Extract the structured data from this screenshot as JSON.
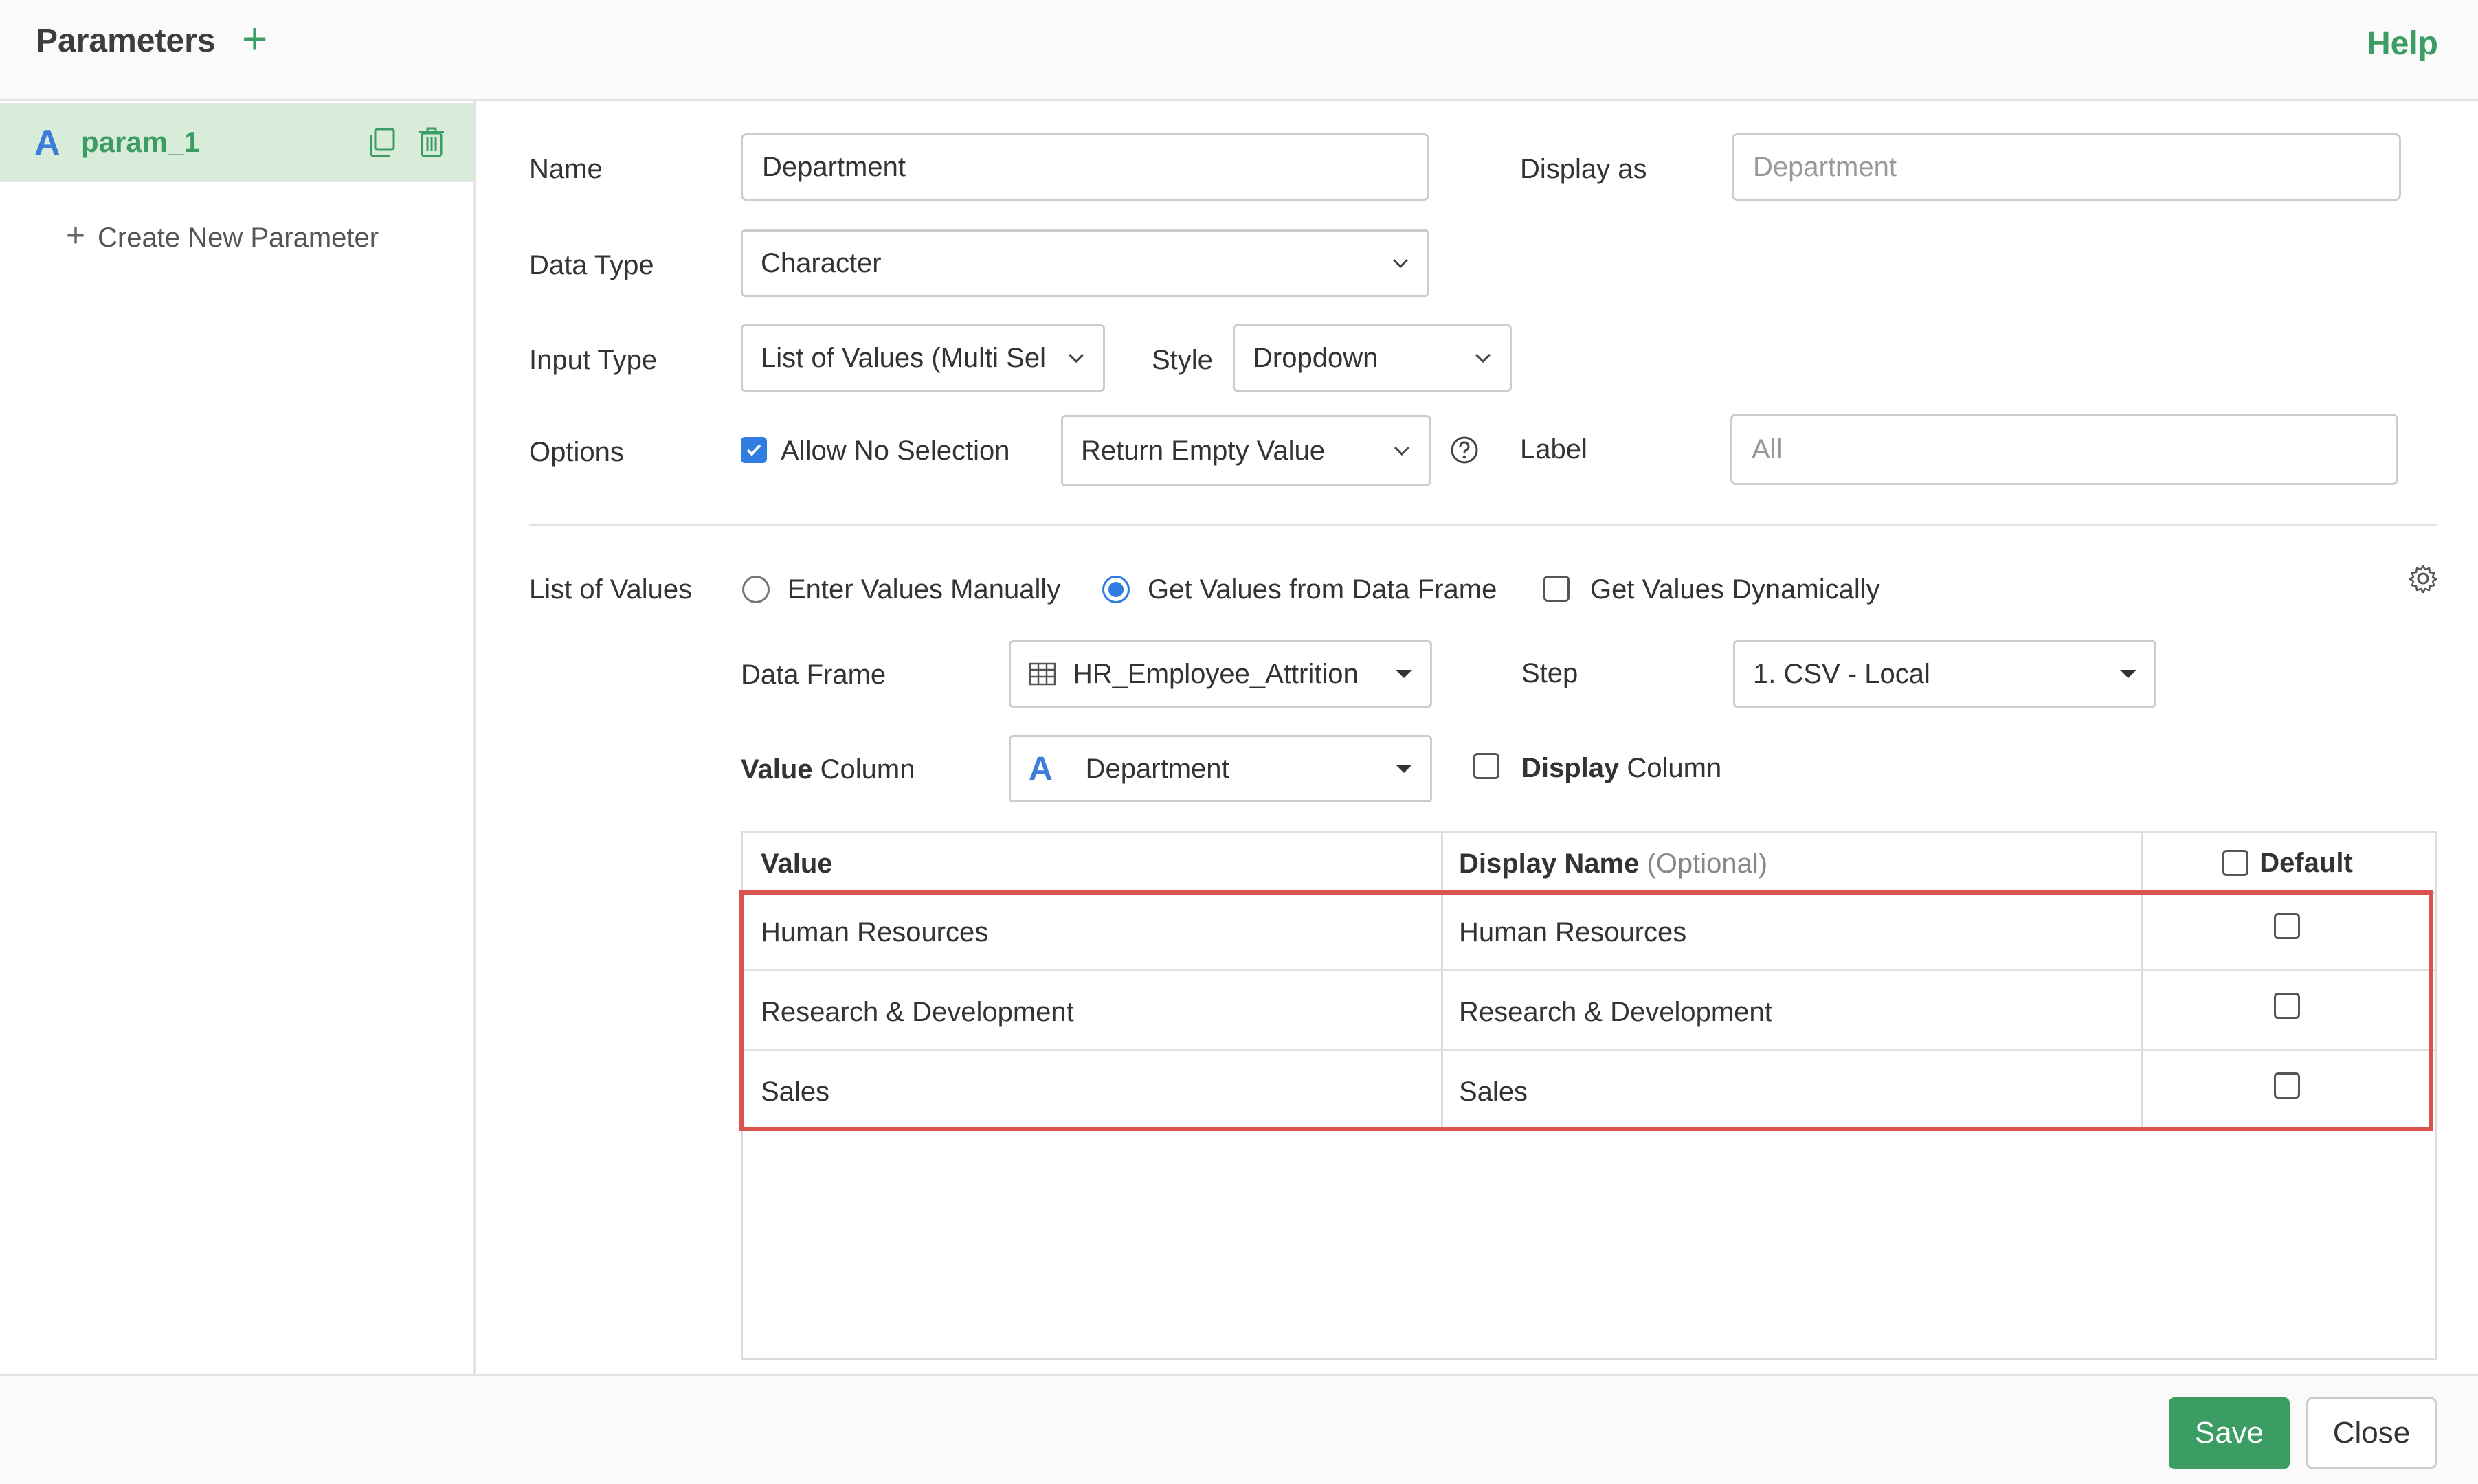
{
  "header": {
    "title": "Parameters",
    "add_icon": "plus-icon",
    "help": "Help"
  },
  "sidebar": {
    "parameter": {
      "type_glyph": "A",
      "name": "param_1"
    },
    "create_label": "Create New Parameter"
  },
  "form": {
    "name_label": "Name",
    "name_value": "Department",
    "display_as_label": "Display as",
    "display_as_placeholder": "Department",
    "data_type_label": "Data Type",
    "data_type_value": "Character",
    "input_type_label": "Input Type",
    "input_type_value": "List of Values (Multi Sel",
    "style_label": "Style",
    "style_value": "Dropdown",
    "options_label": "Options",
    "allow_no_selection": "Allow No Selection",
    "allow_no_selection_checked": true,
    "empty_value_select": "Return Empty Value",
    "label_label": "Label",
    "label_placeholder": "All"
  },
  "list_of_values": {
    "label": "List of Values",
    "mode_manual": "Enter Values Manually",
    "mode_dataframe": "Get Values from Data Frame",
    "mode_dynamic": "Get Values Dynamically",
    "selected_mode": "dataframe",
    "data_frame_label": "Data Frame",
    "data_frame_value": "HR_Employee_Attrition",
    "step_label": "Step",
    "step_value": "1. CSV - Local",
    "value_column_bold": "Value",
    "value_column_rest": " Column",
    "value_column_type": "A",
    "value_column_value": "Department",
    "display_column_bold": "Display",
    "display_column_rest": " Column"
  },
  "table": {
    "headers": {
      "value": "Value",
      "display_name": "Display Name",
      "optional": "(Optional)",
      "default": "Default"
    },
    "rows": [
      {
        "value": "Human Resources",
        "display": "Human Resources"
      },
      {
        "value": "Research & Development",
        "display": "Research & Development"
      },
      {
        "value": "Sales",
        "display": "Sales"
      }
    ]
  },
  "footer": {
    "save": "Save",
    "close": "Close"
  },
  "colors": {
    "accent_green": "#3b9d63",
    "accent_blue": "#2f7de1",
    "highlight_red": "#d9534f"
  }
}
